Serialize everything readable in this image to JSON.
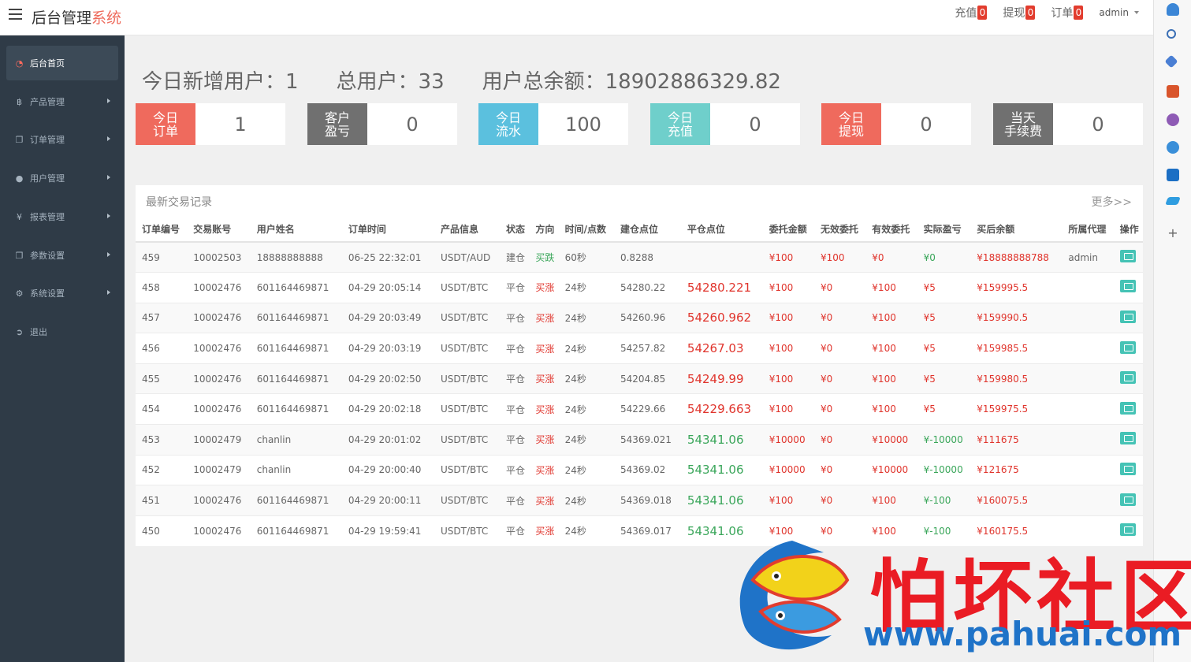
{
  "header": {
    "brand_main": "后台管理",
    "brand_accent": "系统",
    "links": [
      {
        "label": "充值",
        "count": "0"
      },
      {
        "label": "提现",
        "count": "0"
      },
      {
        "label": "订单",
        "count": "0"
      }
    ],
    "user": "admin"
  },
  "sidebar": {
    "items": [
      {
        "label": "后台首页",
        "icon": "dashboard-icon"
      },
      {
        "label": "产品管理",
        "icon": "bitcoin-icon"
      },
      {
        "label": "订单管理",
        "icon": "copy-icon"
      },
      {
        "label": "用户管理",
        "icon": "user-icon"
      },
      {
        "label": "报表管理",
        "icon": "yen-icon"
      },
      {
        "label": "参数设置",
        "icon": "copy-icon"
      },
      {
        "label": "系统设置",
        "icon": "gears-icon"
      },
      {
        "label": "退出",
        "icon": "sign-out-icon"
      }
    ]
  },
  "summary": {
    "new_users": "今日新增用户：1",
    "total_users": "总用户：33",
    "total_balance": "用户总余额：18902886329.82"
  },
  "stats": [
    {
      "label1": "今日",
      "label2": "订单",
      "value": "1",
      "color": "#ef6a5d"
    },
    {
      "label1": "客户",
      "label2": "盈亏",
      "value": "0",
      "color": "#707070"
    },
    {
      "label1": "今日",
      "label2": "流水",
      "value": "100",
      "color": "#5bc0de"
    },
    {
      "label1": "今日",
      "label2": "充值",
      "value": "0",
      "color": "#6fcfcb"
    },
    {
      "label1": "今日",
      "label2": "提现",
      "value": "0",
      "color": "#ef6a5d"
    },
    {
      "label1": "当天",
      "label2": "手续费",
      "value": "0",
      "color": "#707070"
    }
  ],
  "panel": {
    "title": "最新交易记录",
    "more": "更多>>"
  },
  "table": {
    "columns": [
      "订单编号",
      "交易账号",
      "用户姓名",
      "订单时间",
      "产品信息",
      "状态",
      "方向",
      "时间/点数",
      "建仓点位",
      "平仓点位",
      "委托金额",
      "无效委托",
      "有效委托",
      "实际盈亏",
      "买后余额",
      "所属代理",
      "操作"
    ],
    "rows": [
      {
        "id": "459",
        "account": "10002503",
        "name": "18888888888",
        "time": "06-25 22:32:01",
        "product": "USDT/AUD",
        "status": "建仓",
        "direction": "买跌",
        "duration": "60秒",
        "open": "0.8288",
        "close": "",
        "close_class": "",
        "amount": "¥100",
        "invalid": "¥100",
        "valid": "¥0",
        "pnl": "¥0",
        "pnl_class": "green",
        "balance": "¥18888888788",
        "agent": "admin"
      },
      {
        "id": "458",
        "account": "10002476",
        "name": "601164469871",
        "time": "04-29 20:05:14",
        "product": "USDT/BTC",
        "status": "平仓",
        "direction": "买涨",
        "duration": "24秒",
        "open": "54280.22",
        "close": "54280.221",
        "close_class": "red",
        "amount": "¥100",
        "invalid": "¥0",
        "valid": "¥100",
        "pnl": "¥5",
        "pnl_class": "red",
        "balance": "¥159995.5",
        "agent": ""
      },
      {
        "id": "457",
        "account": "10002476",
        "name": "601164469871",
        "time": "04-29 20:03:49",
        "product": "USDT/BTC",
        "status": "平仓",
        "direction": "买涨",
        "duration": "24秒",
        "open": "54260.96",
        "close": "54260.962",
        "close_class": "red",
        "amount": "¥100",
        "invalid": "¥0",
        "valid": "¥100",
        "pnl": "¥5",
        "pnl_class": "red",
        "balance": "¥159990.5",
        "agent": ""
      },
      {
        "id": "456",
        "account": "10002476",
        "name": "601164469871",
        "time": "04-29 20:03:19",
        "product": "USDT/BTC",
        "status": "平仓",
        "direction": "买涨",
        "duration": "24秒",
        "open": "54257.82",
        "close": "54267.03",
        "close_class": "red",
        "amount": "¥100",
        "invalid": "¥0",
        "valid": "¥100",
        "pnl": "¥5",
        "pnl_class": "red",
        "balance": "¥159985.5",
        "agent": ""
      },
      {
        "id": "455",
        "account": "10002476",
        "name": "601164469871",
        "time": "04-29 20:02:50",
        "product": "USDT/BTC",
        "status": "平仓",
        "direction": "买涨",
        "duration": "24秒",
        "open": "54204.85",
        "close": "54249.99",
        "close_class": "red",
        "amount": "¥100",
        "invalid": "¥0",
        "valid": "¥100",
        "pnl": "¥5",
        "pnl_class": "red",
        "balance": "¥159980.5",
        "agent": ""
      },
      {
        "id": "454",
        "account": "10002476",
        "name": "601164469871",
        "time": "04-29 20:02:18",
        "product": "USDT/BTC",
        "status": "平仓",
        "direction": "买涨",
        "duration": "24秒",
        "open": "54229.66",
        "close": "54229.663",
        "close_class": "red",
        "amount": "¥100",
        "invalid": "¥0",
        "valid": "¥100",
        "pnl": "¥5",
        "pnl_class": "red",
        "balance": "¥159975.5",
        "agent": ""
      },
      {
        "id": "453",
        "account": "10002479",
        "name": "chanlin",
        "time": "04-29 20:01:02",
        "product": "USDT/BTC",
        "status": "平仓",
        "direction": "买涨",
        "duration": "24秒",
        "open": "54369.021",
        "close": "54341.06",
        "close_class": "green",
        "amount": "¥10000",
        "invalid": "¥0",
        "valid": "¥10000",
        "pnl": "¥-10000",
        "pnl_class": "green",
        "balance": "¥111675",
        "agent": ""
      },
      {
        "id": "452",
        "account": "10002479",
        "name": "chanlin",
        "time": "04-29 20:00:40",
        "product": "USDT/BTC",
        "status": "平仓",
        "direction": "买涨",
        "duration": "24秒",
        "open": "54369.02",
        "close": "54341.06",
        "close_class": "green",
        "amount": "¥10000",
        "invalid": "¥0",
        "valid": "¥10000",
        "pnl": "¥-10000",
        "pnl_class": "green",
        "balance": "¥121675",
        "agent": ""
      },
      {
        "id": "451",
        "account": "10002476",
        "name": "601164469871",
        "time": "04-29 20:00:11",
        "product": "USDT/BTC",
        "status": "平仓",
        "direction": "买涨",
        "duration": "24秒",
        "open": "54369.018",
        "close": "54341.06",
        "close_class": "green",
        "amount": "¥100",
        "invalid": "¥0",
        "valid": "¥100",
        "pnl": "¥-100",
        "pnl_class": "green",
        "balance": "¥160075.5",
        "agent": ""
      },
      {
        "id": "450",
        "account": "10002476",
        "name": "601164469871",
        "time": "04-29 19:59:41",
        "product": "USDT/BTC",
        "status": "平仓",
        "direction": "买涨",
        "duration": "24秒",
        "open": "54369.017",
        "close": "54341.06",
        "close_class": "green",
        "amount": "¥100",
        "invalid": "¥0",
        "valid": "¥100",
        "pnl": "¥-100",
        "pnl_class": "green",
        "balance": "¥160175.5",
        "agent": ""
      }
    ]
  },
  "watermark": {
    "text": "怕坏社区",
    "url": "www.pahuai.com"
  },
  "colors": {
    "sidebar_bg": "#2f3b47",
    "accent_red": "#ee6b5c",
    "op_button": "#45c3b5"
  }
}
